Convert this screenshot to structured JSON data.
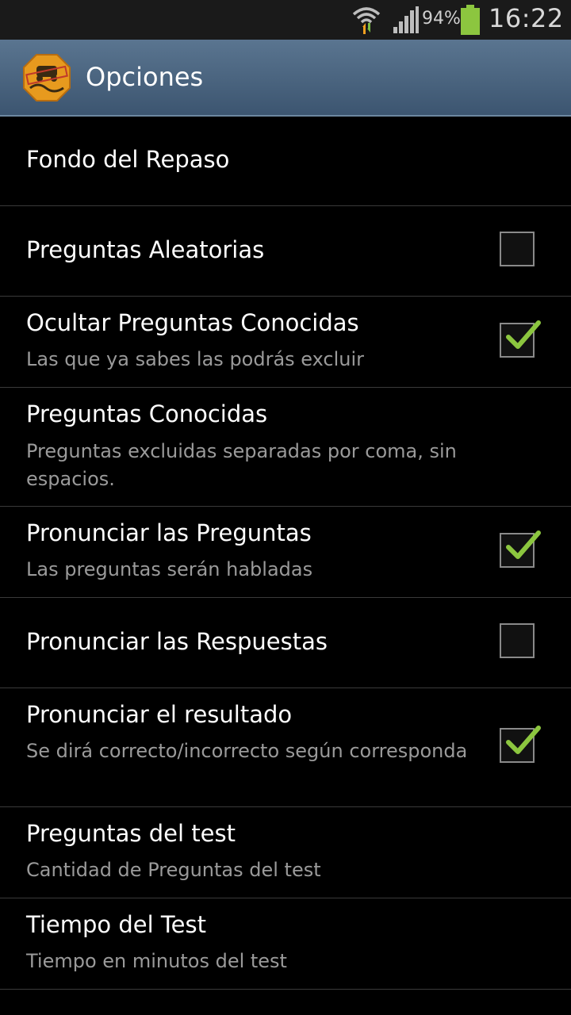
{
  "status_bar": {
    "battery_percent": "94%",
    "time": "16:22",
    "icons": [
      "wifi-icon",
      "signal-icon",
      "battery-icon"
    ],
    "battery_color": "#8cc63f"
  },
  "action_bar": {
    "title": "Opciones",
    "icon": "app-logo-icon"
  },
  "colors": {
    "check_green": "#8cc63f",
    "actionbar_top": "#5a7590",
    "actionbar_bottom": "#3c5570"
  },
  "settings": [
    {
      "title": "Fondo del Repaso",
      "summary": null,
      "checkbox": null
    },
    {
      "title": "Preguntas Aleatorias",
      "summary": null,
      "checkbox": false
    },
    {
      "title": "Ocultar Preguntas Conocidas",
      "summary": "Las que ya sabes las podrás excluir",
      "checkbox": true
    },
    {
      "title": "Preguntas Conocidas",
      "summary": "Preguntas excluidas separadas por coma, sin espacios.",
      "checkbox": null
    },
    {
      "title": "Pronunciar las Preguntas",
      "summary": "Las preguntas serán habladas",
      "checkbox": true
    },
    {
      "title": "Pronunciar las Respuestas",
      "summary": null,
      "checkbox": false
    },
    {
      "title": "Pronunciar el resultado",
      "summary": "Se dirá correcto/incorrecto según corresponda",
      "checkbox": true
    },
    {
      "title": "Preguntas del test",
      "summary": "Cantidad de Preguntas del test",
      "checkbox": null
    },
    {
      "title": "Tiempo del Test",
      "summary": "Tiempo en minutos del test",
      "checkbox": null
    }
  ]
}
